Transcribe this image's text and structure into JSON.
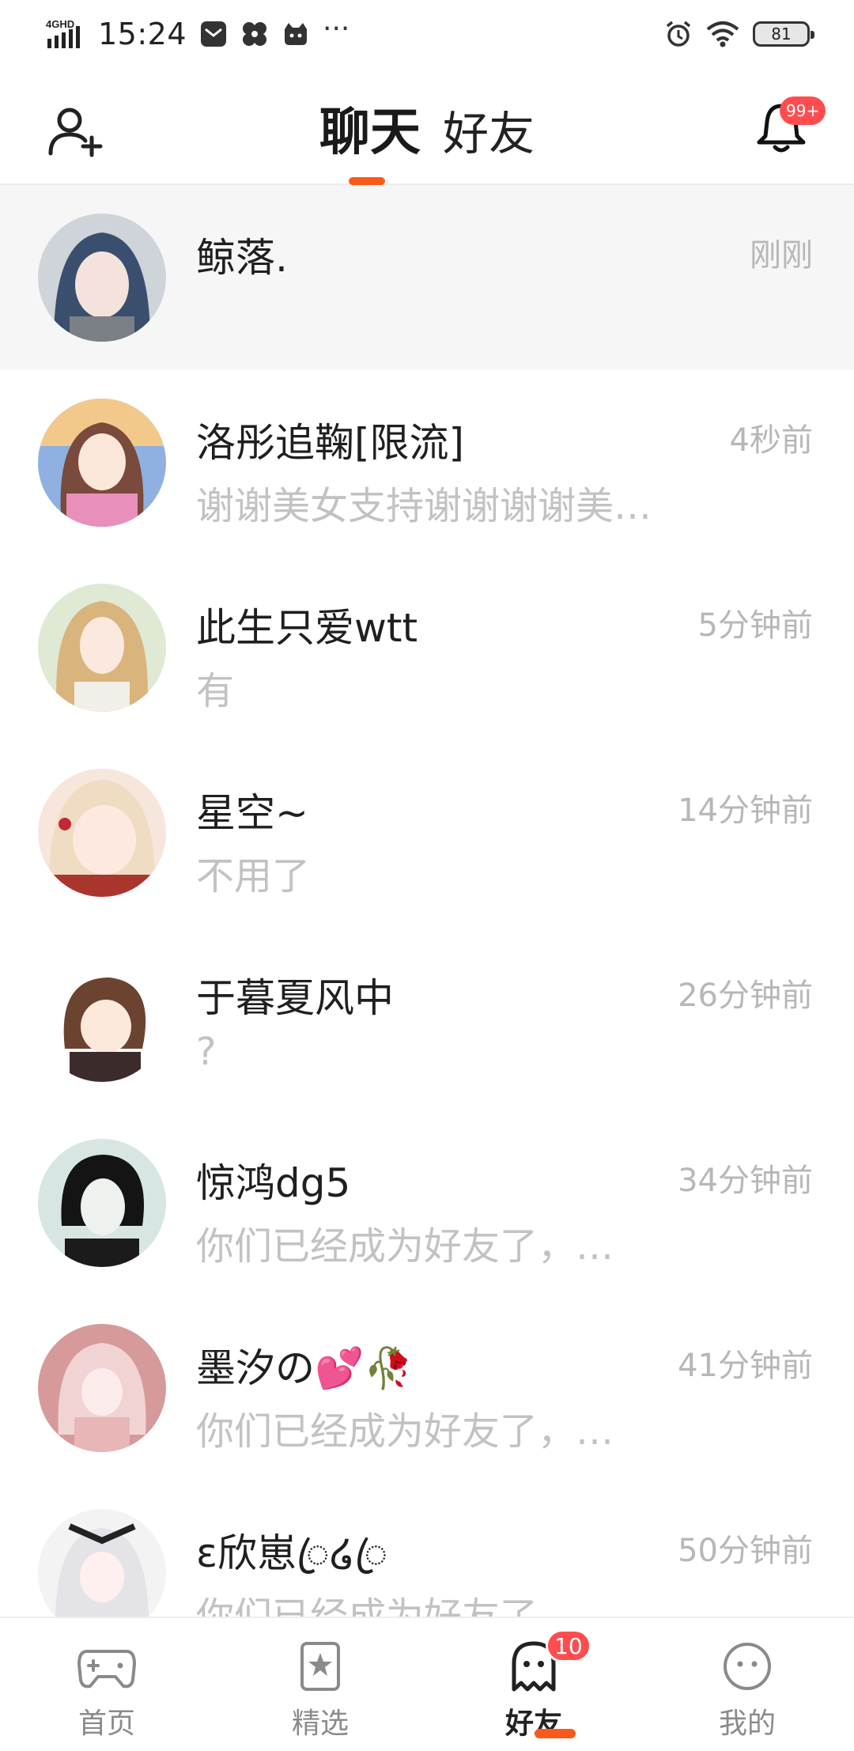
{
  "status_bar": {
    "network": "4GHD",
    "time": "15:24",
    "more": "···",
    "battery": "81"
  },
  "header": {
    "tab_chat": "聊天",
    "tab_friends": "好友",
    "bell_badge": "99+",
    "accent": "#fa5a19"
  },
  "conversations": [
    {
      "name": "鲸落.",
      "time": "刚刚",
      "preview": "",
      "highlight": true
    },
    {
      "name": "洛彤追鞠[限流]",
      "time": "4秒前",
      "preview": "谢谢美女支持谢谢谢谢美…"
    },
    {
      "name": "此生只爱wtt",
      "time": "5分钟前",
      "preview": "有"
    },
    {
      "name": "星空~",
      "time": "14分钟前",
      "preview": "不用了"
    },
    {
      "name": "于暮夏风中",
      "time": "26分钟前",
      "preview": "?"
    },
    {
      "name": "惊鸿dg5",
      "time": "34分钟前",
      "preview": "你们已经成为好友了，…"
    },
    {
      "name": "墨汐の💕🥀",
      "time": "41分钟前",
      "preview": "你们已经成为好友了，…"
    },
    {
      "name": "ɛ欣崽ꦿ໒ꦿ",
      "time": "50分钟前",
      "preview": "你们已经成为好友了，…"
    }
  ],
  "bottom_nav": {
    "items": [
      {
        "label": "首页",
        "icon": "gamepad-icon"
      },
      {
        "label": "精选",
        "icon": "star-bookmark-icon"
      },
      {
        "label": "好友",
        "icon": "ghost-icon",
        "badge": "10",
        "active": true
      },
      {
        "label": "我的",
        "icon": "face-icon"
      }
    ],
    "badge_color": "#ff4d4f"
  }
}
